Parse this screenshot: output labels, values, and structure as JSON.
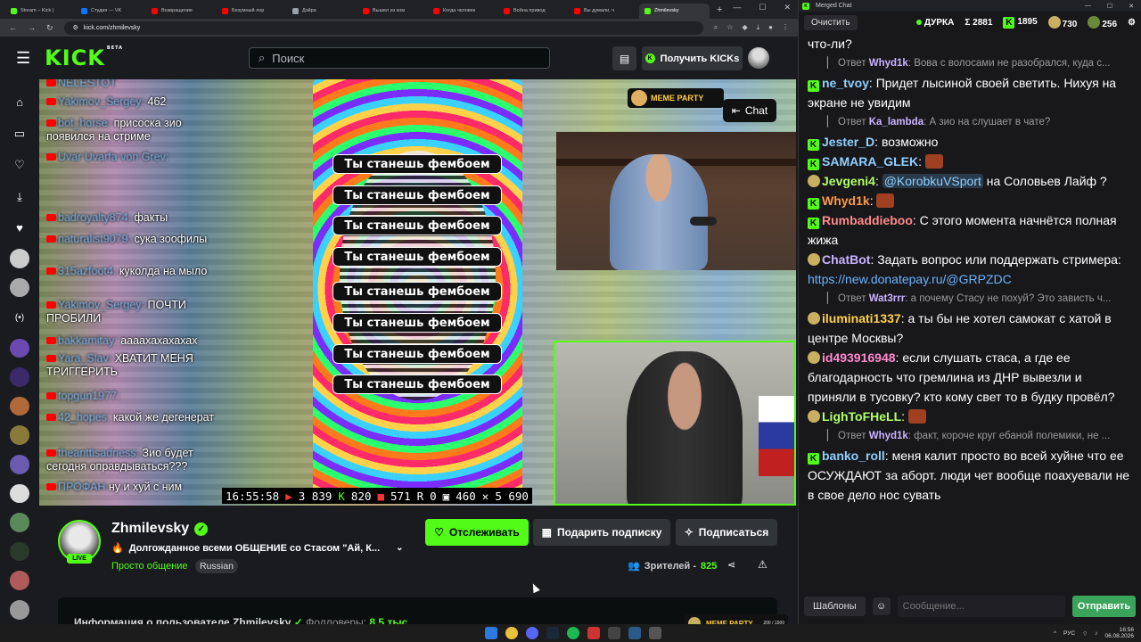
{
  "browser": {
    "tabs": [
      {
        "label": "Stream – Kick |",
        "fav": "k"
      },
      {
        "label": "Студия — VK",
        "fav": "vk"
      },
      {
        "label": "Возвращение",
        "fav": "y"
      },
      {
        "label": "Безумный лор",
        "fav": "y"
      },
      {
        "label": "Дэйра",
        "fav": "d"
      },
      {
        "label": "Вышел из ком",
        "fav": "y"
      },
      {
        "label": "Когда человек",
        "fav": "y"
      },
      {
        "label": "Война привод",
        "fav": "y"
      },
      {
        "label": "Вы думали, ч",
        "fav": "y"
      },
      {
        "label": "Zhmilevsky",
        "fav": "k",
        "active": true
      }
    ],
    "url": "kick.com/zhmilevsky"
  },
  "kick": {
    "logo": "KICK",
    "beta": "BETA",
    "search_placeholder": "Поиск",
    "get_kicks": "Получить KICKs"
  },
  "player": {
    "chat_overlay": [
      {
        "user": "NELESTOT",
        "text": ""
      },
      {
        "user": "Yakimov_Sergey:",
        "text": "462"
      },
      {
        "user": "bot_horse:",
        "text": "присоска зио появился на стриме"
      },
      {
        "user": "Uvar Uvarfa von Grev:",
        "text": ""
      },
      {
        "user": "badroyalty874:",
        "text": "факты"
      },
      {
        "user": "naturalist9079:",
        "text": "сука зоофилы"
      },
      {
        "user": "315azfoot4:",
        "text": "куколда на мыло"
      },
      {
        "user": "Yakimov_Sergey:",
        "text": "ПОЧТИ ПРОБИЛИ"
      },
      {
        "user": "bakkamitay:",
        "text": "аааахахахахах"
      },
      {
        "user": "Yara_Slav:",
        "text": "ХВАТИТ МЕНЯ ТРИГГЕРИТЬ"
      },
      {
        "user": "topgun1977:",
        "text": ""
      },
      {
        "user": "42_hopes:",
        "text": "какой же дегенерат"
      },
      {
        "user": "theanttisadness:",
        "text": "Зио будет сегодня оправдываться???"
      },
      {
        "user": "ПРОФАН",
        "text": "ну и хуй с ним"
      }
    ],
    "psy_text": "Ты станешь фембоем",
    "meme_party": "MEME PARTY",
    "chat_button": "Chat",
    "stats": {
      "time": "16:55:58",
      "yt": "3 839",
      "kick": "820",
      "vk": "571",
      "r": "0",
      "tw": "460",
      "x": "5 690"
    }
  },
  "channel": {
    "name": "Zhmilevsky",
    "live": "LIVE",
    "title": "Долгожданное всеми ОБЩЕНИЕ со Стасом \"Ай, К...",
    "category": "Просто общение",
    "language": "Russian",
    "follow": "Отслеживать",
    "gift": "Подарить подписку",
    "subscribe": "Подписаться",
    "viewers_label": "Зрителей -",
    "viewers": "825",
    "about_prefix": "Информация о пользователе Zhmilevsky",
    "followers_label": "Фолловеры:",
    "followers": "8.5 тыс."
  },
  "merged_chat": {
    "window_title": "Merged Chat",
    "clear": "Очистить",
    "channel": "ДУРКА",
    "sum": "Σ 2881",
    "kick": "1895",
    "s2": "730",
    "s3": "256",
    "templates": "Шаблоны",
    "input_placeholder": "Сообщение...",
    "send": "Отправить",
    "messages": [
      {
        "kind": "plain",
        "text": "что-ли?"
      },
      {
        "kind": "reply",
        "user": "Whyd1k",
        "text": "Вова с волосами не разобрался, куда с..."
      },
      {
        "kind": "msg",
        "badge": "k",
        "user": "ne_tvoy",
        "color": "#8fd0ff",
        "text": "Придет лысиной своей светить. Нихуя на экране не увидим"
      },
      {
        "kind": "reply",
        "user": "Ka_lambda",
        "text": "А зио на слушает в чате?"
      },
      {
        "kind": "msg",
        "badge": "k",
        "user": "Jester_D",
        "color": "#8fd0ff",
        "text": "возможно"
      },
      {
        "kind": "msg",
        "badge": "k",
        "user": "SAMARA_GLEK",
        "color": "#8fd0ff",
        "text": ""
      },
      {
        "kind": "msg",
        "badge": "e",
        "user": "Jevgeni4",
        "color": "#b0ff6a",
        "mention": "@KorobkuVSport",
        "text": "на Соловьев Лайф ?"
      },
      {
        "kind": "msg",
        "badge": "k",
        "user": "Whyd1k",
        "color": "#ff9a4a",
        "text": ""
      },
      {
        "kind": "msg",
        "badge": "k",
        "user": "Rumbaddieboo",
        "color": "#ff8a8a",
        "text": "С этого момента начнётся полная жижа"
      },
      {
        "kind": "msg",
        "badge": "e",
        "user": "ChatBot",
        "color": "#c9b3ff",
        "text": "Задать вопрос или поддержать стримера:",
        "link": "https://new.donatepay.ru/@GRPZDC"
      },
      {
        "kind": "reply",
        "user": "Wat3rrr",
        "text": "а почему Стасу не похуй? Это зависть ч..."
      },
      {
        "kind": "msg",
        "badge": "e",
        "user": "iluminati1337",
        "color": "#ffd24a",
        "text": "а ты бы не хотел самокат с хатой в центре Москвы?"
      },
      {
        "kind": "msg",
        "badge": "e",
        "user": "id493916948",
        "color": "#ff8ad0",
        "text": "если слушать стаса, а где ее благодарность что гремлина из ДНР вывезли и приняли в тусовку? кто кому свет то в будку провёл?"
      },
      {
        "kind": "msg",
        "badge": "e",
        "user": "LighToFHeLL",
        "color": "#b0ff6a",
        "text": ""
      },
      {
        "kind": "reply",
        "user": "Whyd1k",
        "text": "факт, короче круг ебаной полемики, не ..."
      },
      {
        "kind": "msg",
        "badge": "k",
        "user": "banko_roll",
        "color": "#8fd0ff",
        "text": "меня калит просто во всей хуйне что ее ОСУЖДАЮТ за аборт. люди чет вообще поахуевали не в свое дело нос сувать"
      }
    ]
  },
  "overlay_meme": {
    "label": "MEME PARTY",
    "progress": "200 / 1500"
  },
  "taskbar": {
    "lang": "РУС",
    "time": "16:56",
    "date": "06.08.2026"
  }
}
